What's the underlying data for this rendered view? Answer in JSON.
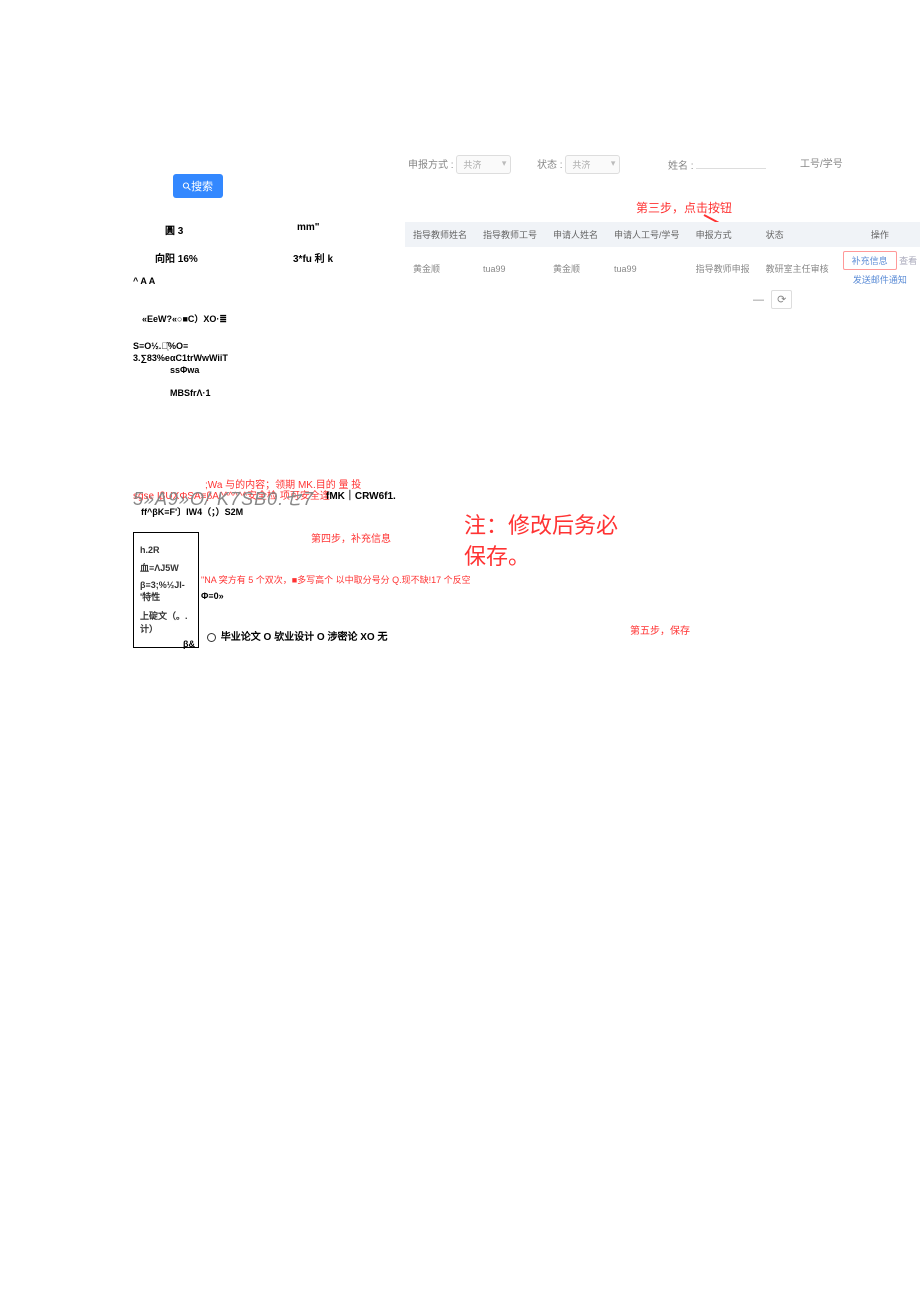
{
  "filters": {
    "mode_label": "申报方式 :",
    "mode_value": "共济",
    "status_label": "状态 :",
    "status_value": "共济",
    "name_label": "姓名 :",
    "id_label": "工号/学号"
  },
  "search_button": "搜索",
  "left_fragments": {
    "r1a": "圓 3",
    "r1b": "mm\"",
    "r2a": "向阳 16%",
    "r2b": "3*fu 利 k",
    "r3": "^ A A",
    "r4": "«EeW?«○■C）XO·≣",
    "r5a": "S≡O½.买᷂᷉%O≡",
    "r5b": "3.∑83%eαC1trWwWiiT",
    "r5c": "ssΦwa",
    "r6": "MBSfrΛ·1"
  },
  "step3": "第三步，点击按钮",
  "table": {
    "headers": [
      "指导教师姓名",
      "指导教师工号",
      "申请人姓名",
      "申请人工号/学号",
      "申报方式",
      "状态",
      "操作"
    ],
    "row": [
      "黄金顺",
      "tua99",
      "黄金顺",
      "tua99",
      "指导教师申报",
      "教研室主任审核"
    ],
    "action_btn": "补充信息",
    "action_link": "查看",
    "secondary_link": "发送邮件通知"
  },
  "pager": {
    "dash": "—",
    "refresh": "⟳"
  },
  "bottom": {
    "line1": ";Wa 与的内容；领期 MK.目的 量 投",
    "line2_a": "sgse IβUXΦSA≡βA^^^^^^安全检   项可安全逢",
    "line2_b": "fMK｜CRW6f1.",
    "big_gray": "5»A9»O/  K7SB0.セ7",
    "line3": "ff^βK≡F'〕IW4（；）S2M",
    "step4": "第四步，补充信息",
    "box": {
      "b1": "h.2R",
      "b2": "血≡ΛJ5W",
      "b3a": "β≡3;%½Jl-'特性",
      "b3b": "Φ≡0»",
      "b4a": "上碇文（。.计）",
      "b4b": "β&"
    },
    "inline_red1": "\"NA 突方有 5 个双次，■多写高个  以中取分号分 Q.现不缺!17 个反空",
    "radios": "毕业论文 O 欤业设计 O 涉密论 XO 无",
    "big_note1": "注：修改后务必",
    "big_note2": "保存。",
    "step5": "第五步，保存"
  }
}
